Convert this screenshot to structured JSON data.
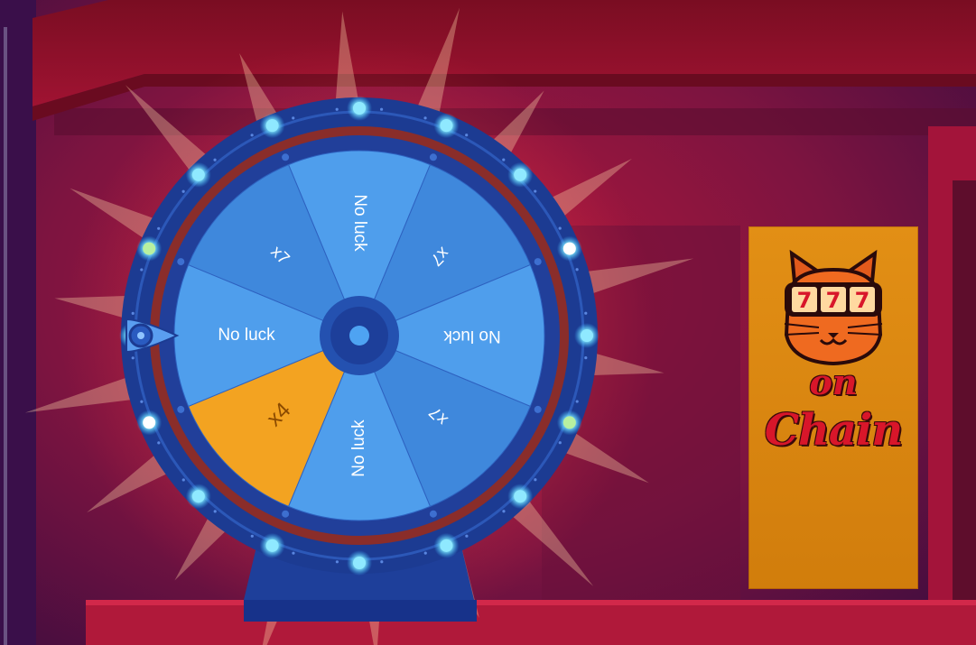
{
  "wheel": {
    "pointer_icon": "pointer-icon",
    "selected_index": 5,
    "segments": [
      {
        "label": "No luck",
        "color": "#4f9eec"
      },
      {
        "label": "x7",
        "color": "#3f88dc"
      },
      {
        "label": "No luck",
        "color": "#4f9eec"
      },
      {
        "label": "x7",
        "color": "#3f88dc"
      },
      {
        "label": "No luck",
        "color": "#4f9eec"
      },
      {
        "label": "x4",
        "color": "#f3a321"
      },
      {
        "label": "No luck",
        "color": "#4f9eec"
      },
      {
        "label": "x7",
        "color": "#3f88dc"
      }
    ]
  },
  "sign": {
    "reel_digits": [
      "7",
      "7",
      "7"
    ],
    "line1": "on",
    "line2": "Chain",
    "logo_icon": "cat-slot-logo-icon"
  },
  "colors": {
    "wheel_rim": "#1d3e98",
    "highlight": "#f3a321",
    "sign_bg": "#e08b12",
    "wall": "#8c1538"
  }
}
